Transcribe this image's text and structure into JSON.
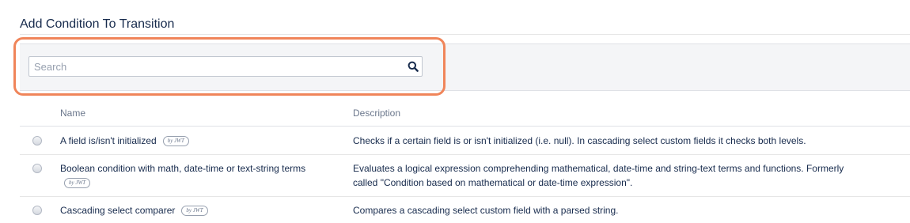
{
  "dialog": {
    "title": "Add Condition To Transition"
  },
  "search": {
    "placeholder": "Search",
    "value": ""
  },
  "table": {
    "columns": {
      "name": "Name",
      "description": "Description"
    },
    "rows": [
      {
        "name": "A field is/isn't initialized",
        "badge": "by JWT",
        "description": "Checks if a certain field is or isn't initialized (i.e. null). In cascading select custom fields it checks both levels."
      },
      {
        "name": "Boolean condition with math, date-time or text-string terms",
        "badge": "by JWT",
        "description_line1": "Evaluates a logical expression comprehending mathematical, date-time and string-text terms and functions. Formerly",
        "description_line2": "called \"Condition based on mathematical or date-time expression\"."
      },
      {
        "name": "Cascading select comparer",
        "badge": "by JWT",
        "description": "Compares a cascading select custom field with a parsed string."
      }
    ]
  },
  "colors": {
    "highlight": "#f0855a",
    "text": "#172b4d",
    "muted": "#6b778c"
  }
}
